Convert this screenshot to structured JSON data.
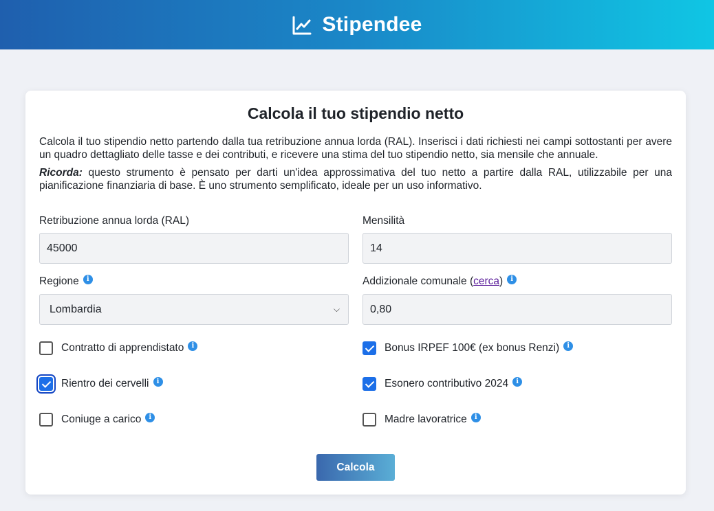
{
  "header": {
    "brand": "Stipendee",
    "icon": "line-chart-icon"
  },
  "card": {
    "title": "Calcola il tuo stipendio netto",
    "intro": "Calcola il tuo stipendio netto partendo dalla tua retribuzione annua lorda (RAL). Inserisci i dati richiesti nei campi sottostanti per avere un quadro dettagliato delle tasse e dei contributi, e ricevere una stima del tuo stipendio netto, sia mensile che annuale.",
    "reminder_label": "Ricorda:",
    "reminder_text": " questo strumento è pensato per darti un'idea approssimativa del tuo netto a partire dalla RAL, utilizzabile per una pianificazione finanziaria di base. È uno strumento semplificato, ideale per un uso informativo."
  },
  "form": {
    "ral_label": "Retribuzione annua lorda (RAL)",
    "ral_value": "45000",
    "mensilita_label": "Mensilità",
    "mensilita_value": "14",
    "regione_label": "Regione",
    "regione_value": "Lombardia",
    "comunale_label_pre": "Addizionale comunale (",
    "comunale_link": "cerca",
    "comunale_label_post": ")",
    "comunale_value": "0,80",
    "info_glyph": "i"
  },
  "checkboxes": {
    "apprendistato": {
      "label": "Contratto di apprendistato",
      "checked": false
    },
    "bonus_irpef": {
      "label": "Bonus IRPEF 100€ (ex bonus Renzi)",
      "checked": true
    },
    "rientro": {
      "label": "Rientro dei cervelli",
      "checked": true
    },
    "esonero": {
      "label": "Esonero contributivo 2024",
      "checked": true
    },
    "coniuge": {
      "label": "Coniuge a carico",
      "checked": false
    },
    "madre": {
      "label": "Madre lavoratrice",
      "checked": false
    }
  },
  "submit": {
    "label": "Calcola"
  },
  "colors": {
    "accent": "#1c6fe8",
    "header_start": "#1f5fae",
    "header_end": "#10c6e4",
    "info": "#2e8fe6"
  }
}
